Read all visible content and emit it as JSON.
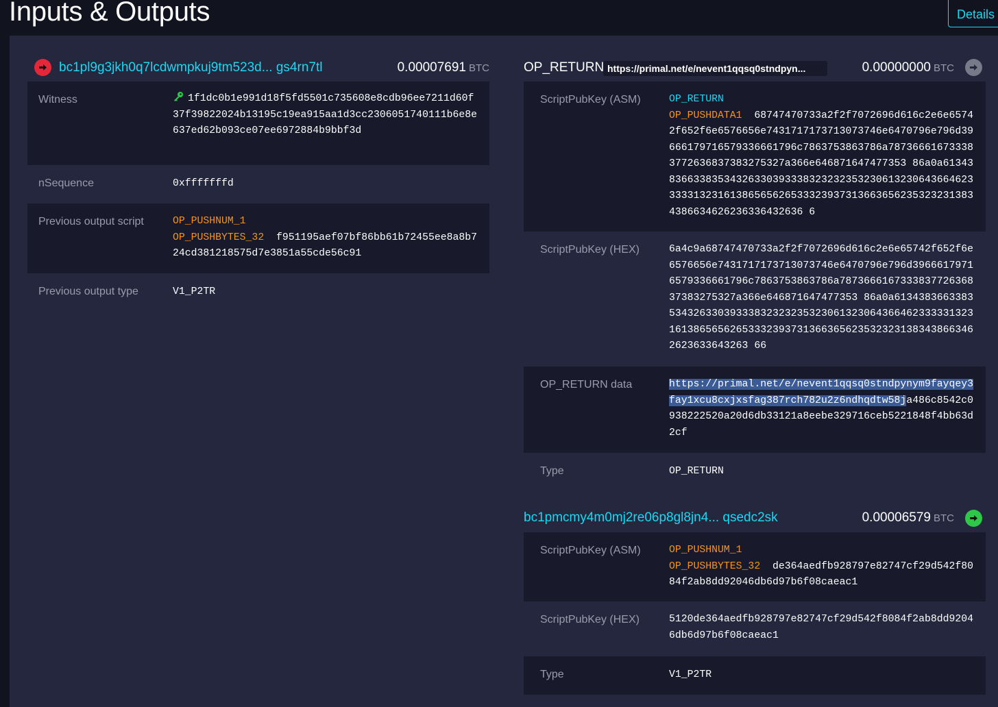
{
  "page_title": "Inputs & Outputs",
  "details_button": "Details",
  "input": {
    "address": "bc1pl9g3jkh0q7lcdwmpkuj9tm523d... gs4rn7tl",
    "amount": "0.00007691",
    "unit": "BTC",
    "witness_label": "Witness",
    "witness_value": "1f1dc0b1e991d18f5fd5501c735608e8cdb96ee7211d60f37f39822024b13195c19ea915aa1d3cc2306051740111b6e8e637ed62b093ce07ee6972884b9bbf3d",
    "nsequence_label": "nSequence",
    "nsequence_value": "0xfffffffd",
    "prev_script_label": "Previous output script",
    "prev_script_op1": "OP_PUSHNUM_1",
    "prev_script_op2": "OP_PUSHBYTES_32",
    "prev_script_data": "f951195aef07bf86bb61b72455ee8a8b724cd381218575d7e3851a55cde56c91",
    "prev_type_label": "Previous output type",
    "prev_type_value": "V1_P2TR"
  },
  "output_opreturn": {
    "label": "OP_RETURN",
    "url_chip": "https://primal.net/e/nevent1qqsq0stndpyn...",
    "amount": "0.00000000",
    "unit": "BTC",
    "asm_label": "ScriptPubKey (ASM)",
    "asm_op1": "OP_RETURN",
    "asm_op2": "OP_PUSHDATA1",
    "asm_data": "68747470733a2f2f7072696d616c2e6e65742f652f6e6576656e7431717173713073746e6470796e796d39666179716579336661796c7863753863786a787366616733383772636837383275327a366e646871647477353 86a0a6134383663383534326330393338323232353230613230643664623333313231613865656265333239373136636562353232313834386634626236336432636 6",
    "hex_label": "ScriptPubKey (HEX)",
    "hex_value": "6a4c9a68747470733a2f2f7072696d616c2e6e65742f652f6e6576656e7431717173713073746e6470796e796d39666179716579336661796c7863753863786a787366616733383772636837383275327a366e646871647477353 86a0a613438366338353432633039333832323235323061323064366462333331323161386565626533323937313663656235323231383438663462623633643263 66",
    "opreturn_data_label": "OP_RETURN data",
    "opreturn_data_highlight": "https://primal.net/e/nevent1qqsq0stndpynym9fayqey3fay1xcu8cxjxsfag387rch782u2z6ndhqdtw58j",
    "opreturn_data_rest": "a486c8542c0938222520a20d6db33121a8eebe329716ceb5221848f4bb63d2cf",
    "type_label": "Type",
    "type_value": "OP_RETURN"
  },
  "output2": {
    "address": "bc1pmcmy4m0mj2re06p8gl8jn4... qsedc2sk",
    "amount": "0.00006579",
    "unit": "BTC",
    "asm_label": "ScriptPubKey (ASM)",
    "asm_op1": "OP_PUSHNUM_1",
    "asm_op2": "OP_PUSHBYTES_32",
    "asm_data": "de364aedfb928797e82747cf29d542f8084f2ab8dd92046db6d97b6f08caeac1",
    "hex_label": "ScriptPubKey (HEX)",
    "hex_value": "5120de364aedfb928797e82747cf29d542f8084f2ab8dd92046db6d97b6f08caeac1",
    "type_label": "Type",
    "type_value": "V1_P2TR"
  },
  "icons": {
    "input_arrow": "arrow-right-red-circle-icon",
    "opreturn_arrow": "arrow-right-grey-circle-icon",
    "output_arrow": "arrow-right-green-circle-icon",
    "witness_key": "key-icon"
  },
  "colors": {
    "accent": "#1bd8f4",
    "opcode": "#f7931a",
    "panel": "#24273e",
    "row_dark": "#181a2b",
    "input_red": "#e4283a",
    "output_green": "#2ec74a"
  }
}
